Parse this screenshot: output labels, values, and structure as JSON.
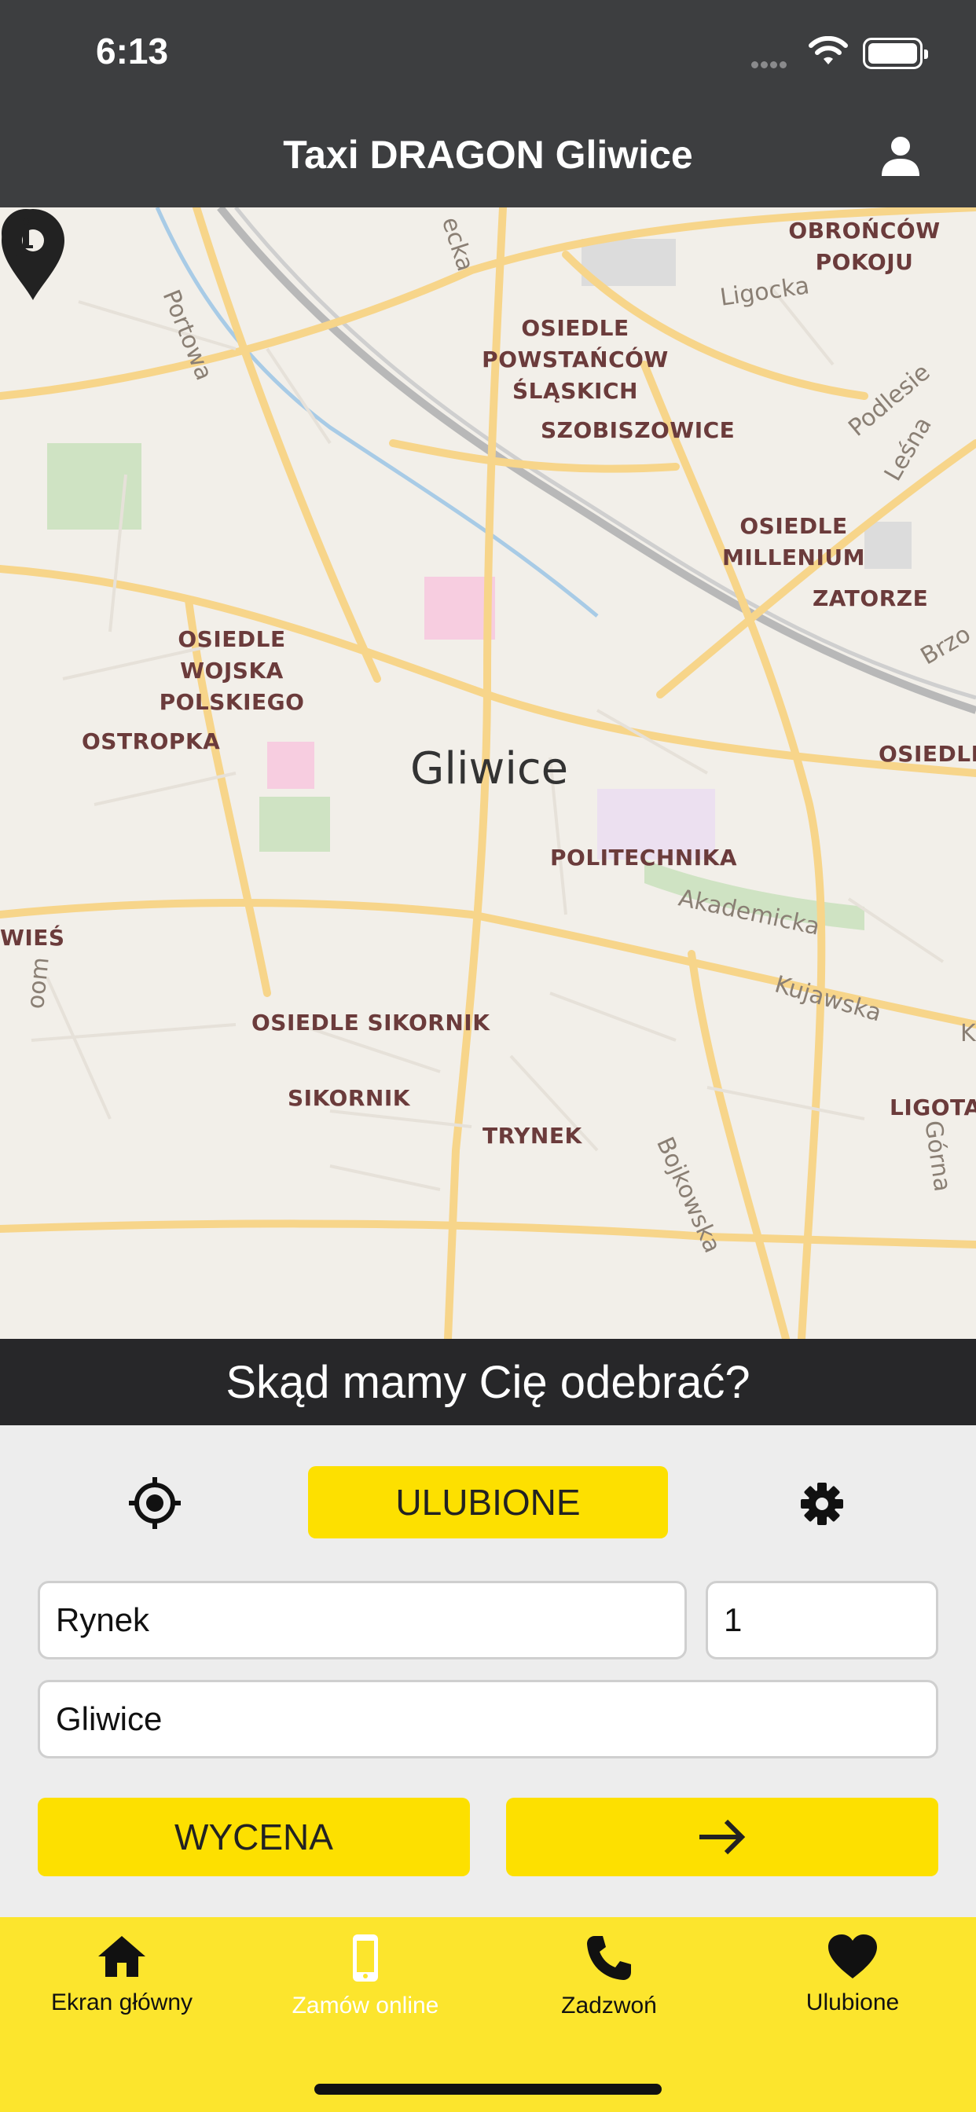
{
  "status": {
    "time": "6:13"
  },
  "header": {
    "title": "Taxi DRAGON Gliwice"
  },
  "map": {
    "city": "Gliwice",
    "districts": [
      "OBROŃCÓW POKOJU",
      "OSIEDLE POWSTAŃCÓW ŚLĄSKICH",
      "SZOBISZOWICE",
      "OSIEDLE MILLENIUM",
      "ZATORZE",
      "OSIEDLE WOJSKA POLSKIEGO",
      "OSTROPKA",
      "OSIEDLE",
      "POLITECHNIKA",
      "WIEŚ",
      "OSIEDLE SIKORNIK",
      "SIKORNIK",
      "TRYNEK",
      "LIGOTA"
    ],
    "streets": [
      "Portowa",
      "Ligocka",
      "Podlesie",
      "Leśna",
      "Brzo",
      "Akademicka",
      "Kujawska",
      "Bojkowska",
      "Górna",
      "ecka",
      "oom",
      "K"
    ]
  },
  "prompt": {
    "question": "Skąd mamy Cię odebrać?"
  },
  "form": {
    "favorites_label": "ULUBIONE",
    "street_value": "Rynek",
    "number_value": "1",
    "city_value": "Gliwice",
    "estimate_label": "WYCENA"
  },
  "tabs": [
    {
      "label": "Ekran główny",
      "icon": "home-icon"
    },
    {
      "label": "Zamów online",
      "icon": "phone-device-icon"
    },
    {
      "label": "Zadzwoń",
      "icon": "call-icon"
    },
    {
      "label": "Ulubione",
      "icon": "heart-icon"
    }
  ],
  "colors": {
    "accent": "#fde000",
    "tabbar": "#fce52d",
    "header": "#3d3e40",
    "banner": "#272729"
  }
}
